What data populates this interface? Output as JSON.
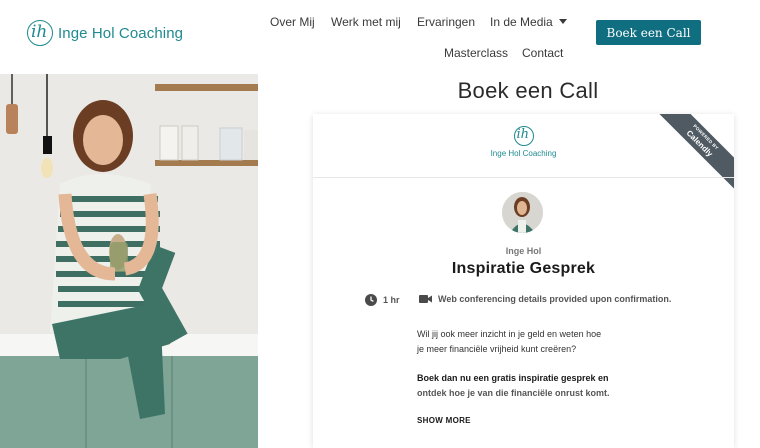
{
  "header": {
    "logo_text": "Inge Hol Coaching",
    "logo_monogram": "ih",
    "nav": {
      "over_mij": "Over Mij",
      "werk_met_mij": "Werk met mij",
      "ervaringen": "Ervaringen",
      "in_de_media": "In de Media",
      "masterclass": "Masterclass",
      "contact": "Contact"
    },
    "cta_label": "Boek een Call"
  },
  "main": {
    "page_title": "Boek een Call"
  },
  "calendly": {
    "logo_text": "Inge Hol Coaching",
    "logo_monogram": "ih",
    "ribbon_small": "POWERED BY",
    "ribbon_brand": "Calendly",
    "host_name": "Inge Hol",
    "event_title": "Inspiratie Gesprek",
    "duration": "1 hr",
    "location": "Web conferencing details provided upon confirmation.",
    "description": {
      "line1": "Wil jij ook meer inzicht in je geld en weten hoe",
      "line2": "je meer financiële vrijheid kunt creëren?",
      "line3": "Boek dan nu een gratis inspiratie gesprek en",
      "line4": "ontdek hoe je van die financiële onrust komt."
    },
    "show_more": "SHOW MORE"
  },
  "colors": {
    "brand_teal": "#1f8a8f",
    "cta_bg": "#0f6e80",
    "ribbon_bg": "#4f5a62"
  }
}
